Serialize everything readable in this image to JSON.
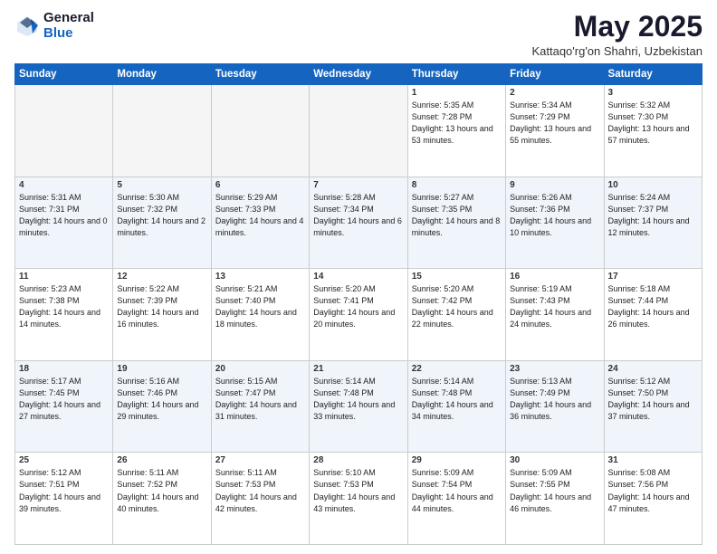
{
  "header": {
    "logo_general": "General",
    "logo_blue": "Blue",
    "month_title": "May 2025",
    "location": "Kattaqo'rg'on Shahri, Uzbekistan"
  },
  "days_of_week": [
    "Sunday",
    "Monday",
    "Tuesday",
    "Wednesday",
    "Thursday",
    "Friday",
    "Saturday"
  ],
  "weeks": [
    [
      {
        "day": "",
        "info": ""
      },
      {
        "day": "",
        "info": ""
      },
      {
        "day": "",
        "info": ""
      },
      {
        "day": "",
        "info": ""
      },
      {
        "day": "1",
        "info": "Sunrise: 5:35 AM\nSunset: 7:28 PM\nDaylight: 13 hours\nand 53 minutes."
      },
      {
        "day": "2",
        "info": "Sunrise: 5:34 AM\nSunset: 7:29 PM\nDaylight: 13 hours\nand 55 minutes."
      },
      {
        "day": "3",
        "info": "Sunrise: 5:32 AM\nSunset: 7:30 PM\nDaylight: 13 hours\nand 57 minutes."
      }
    ],
    [
      {
        "day": "4",
        "info": "Sunrise: 5:31 AM\nSunset: 7:31 PM\nDaylight: 14 hours\nand 0 minutes."
      },
      {
        "day": "5",
        "info": "Sunrise: 5:30 AM\nSunset: 7:32 PM\nDaylight: 14 hours\nand 2 minutes."
      },
      {
        "day": "6",
        "info": "Sunrise: 5:29 AM\nSunset: 7:33 PM\nDaylight: 14 hours\nand 4 minutes."
      },
      {
        "day": "7",
        "info": "Sunrise: 5:28 AM\nSunset: 7:34 PM\nDaylight: 14 hours\nand 6 minutes."
      },
      {
        "day": "8",
        "info": "Sunrise: 5:27 AM\nSunset: 7:35 PM\nDaylight: 14 hours\nand 8 minutes."
      },
      {
        "day": "9",
        "info": "Sunrise: 5:26 AM\nSunset: 7:36 PM\nDaylight: 14 hours\nand 10 minutes."
      },
      {
        "day": "10",
        "info": "Sunrise: 5:24 AM\nSunset: 7:37 PM\nDaylight: 14 hours\nand 12 minutes."
      }
    ],
    [
      {
        "day": "11",
        "info": "Sunrise: 5:23 AM\nSunset: 7:38 PM\nDaylight: 14 hours\nand 14 minutes."
      },
      {
        "day": "12",
        "info": "Sunrise: 5:22 AM\nSunset: 7:39 PM\nDaylight: 14 hours\nand 16 minutes."
      },
      {
        "day": "13",
        "info": "Sunrise: 5:21 AM\nSunset: 7:40 PM\nDaylight: 14 hours\nand 18 minutes."
      },
      {
        "day": "14",
        "info": "Sunrise: 5:20 AM\nSunset: 7:41 PM\nDaylight: 14 hours\nand 20 minutes."
      },
      {
        "day": "15",
        "info": "Sunrise: 5:20 AM\nSunset: 7:42 PM\nDaylight: 14 hours\nand 22 minutes."
      },
      {
        "day": "16",
        "info": "Sunrise: 5:19 AM\nSunset: 7:43 PM\nDaylight: 14 hours\nand 24 minutes."
      },
      {
        "day": "17",
        "info": "Sunrise: 5:18 AM\nSunset: 7:44 PM\nDaylight: 14 hours\nand 26 minutes."
      }
    ],
    [
      {
        "day": "18",
        "info": "Sunrise: 5:17 AM\nSunset: 7:45 PM\nDaylight: 14 hours\nand 27 minutes."
      },
      {
        "day": "19",
        "info": "Sunrise: 5:16 AM\nSunset: 7:46 PM\nDaylight: 14 hours\nand 29 minutes."
      },
      {
        "day": "20",
        "info": "Sunrise: 5:15 AM\nSunset: 7:47 PM\nDaylight: 14 hours\nand 31 minutes."
      },
      {
        "day": "21",
        "info": "Sunrise: 5:14 AM\nSunset: 7:48 PM\nDaylight: 14 hours\nand 33 minutes."
      },
      {
        "day": "22",
        "info": "Sunrise: 5:14 AM\nSunset: 7:48 PM\nDaylight: 14 hours\nand 34 minutes."
      },
      {
        "day": "23",
        "info": "Sunrise: 5:13 AM\nSunset: 7:49 PM\nDaylight: 14 hours\nand 36 minutes."
      },
      {
        "day": "24",
        "info": "Sunrise: 5:12 AM\nSunset: 7:50 PM\nDaylight: 14 hours\nand 37 minutes."
      }
    ],
    [
      {
        "day": "25",
        "info": "Sunrise: 5:12 AM\nSunset: 7:51 PM\nDaylight: 14 hours\nand 39 minutes."
      },
      {
        "day": "26",
        "info": "Sunrise: 5:11 AM\nSunset: 7:52 PM\nDaylight: 14 hours\nand 40 minutes."
      },
      {
        "day": "27",
        "info": "Sunrise: 5:11 AM\nSunset: 7:53 PM\nDaylight: 14 hours\nand 42 minutes."
      },
      {
        "day": "28",
        "info": "Sunrise: 5:10 AM\nSunset: 7:53 PM\nDaylight: 14 hours\nand 43 minutes."
      },
      {
        "day": "29",
        "info": "Sunrise: 5:09 AM\nSunset: 7:54 PM\nDaylight: 14 hours\nand 44 minutes."
      },
      {
        "day": "30",
        "info": "Sunrise: 5:09 AM\nSunset: 7:55 PM\nDaylight: 14 hours\nand 46 minutes."
      },
      {
        "day": "31",
        "info": "Sunrise: 5:08 AM\nSunset: 7:56 PM\nDaylight: 14 hours\nand 47 minutes."
      }
    ]
  ]
}
